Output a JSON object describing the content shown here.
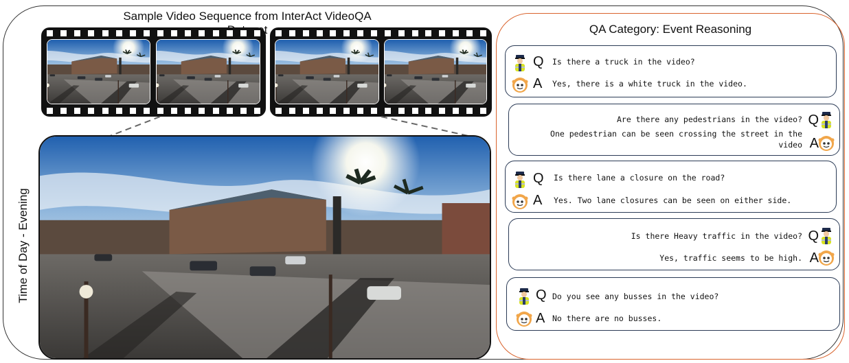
{
  "figure": {
    "strip_title": "Sample Video Sequence from InterAct VideoQA Dataset",
    "side_label": "Time of Day -   Evening",
    "qa_title": "QA Category: Event Reasoning"
  },
  "icons": {
    "question": "police-officer-icon",
    "answer": "robot-assistant-icon"
  },
  "colors": {
    "qa_border": "#d9622b",
    "box_border": "#2a3a55",
    "film": "#111111"
  },
  "qa": [
    {
      "q_letter": "Q",
      "a_letter": "A",
      "question": "Is there a truck in the video?",
      "answer": "Yes, there is a white truck in the video."
    },
    {
      "q_letter": "Q",
      "a_letter": "A",
      "question": "Are there any pedestrians in the video?",
      "answer": "One pedestrian can be seen crossing the street in the video"
    },
    {
      "q_letter": "Q",
      "a_letter": "A",
      "question": "Is there lane a closure on the road?",
      "answer": "Yes. Two lane closures can be seen on either side."
    },
    {
      "q_letter": "Q",
      "a_letter": "A",
      "question": "Is there Heavy traffic in the video?",
      "answer": "Yes, traffic seems to be high."
    },
    {
      "q_letter": "Q",
      "a_letter": "A",
      "question": "Do you see any busses in the video?",
      "answer": "No there are no busses."
    }
  ]
}
